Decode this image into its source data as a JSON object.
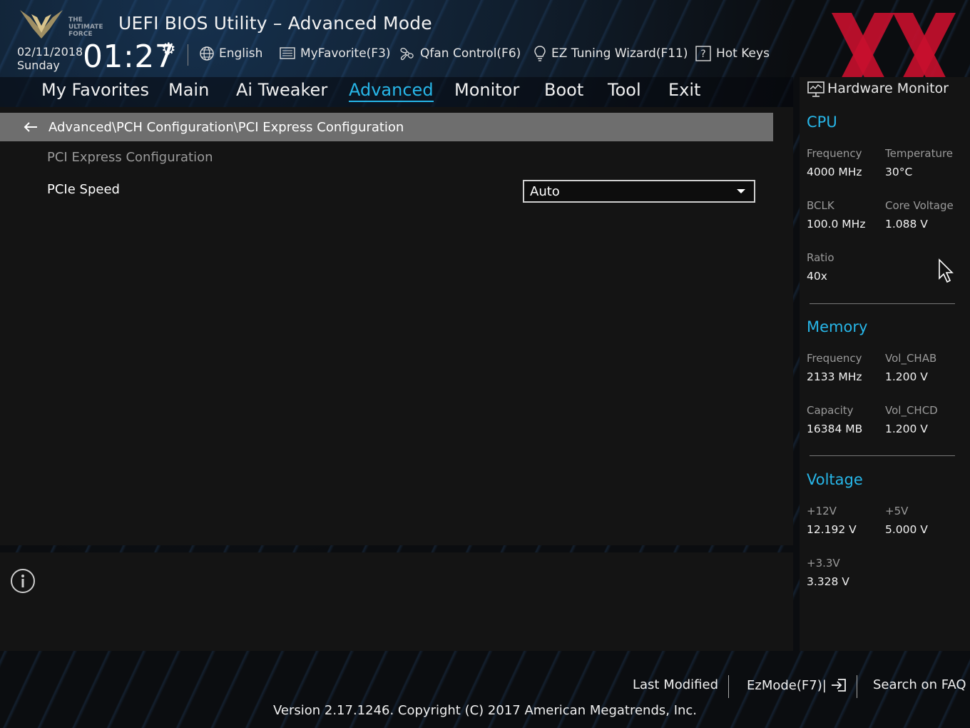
{
  "header": {
    "logo_text": "THE ULTIMATE FORCE",
    "title": "UEFI BIOS Utility – Advanced Mode",
    "date": "02/11/2018",
    "day": "Sunday",
    "time": "01:27",
    "toolbar": [
      {
        "label": "English",
        "icon": "globe-icon"
      },
      {
        "label": "MyFavorite(F3)",
        "icon": "favorite-list-icon"
      },
      {
        "label": "Qfan Control(F6)",
        "icon": "fan-icon"
      },
      {
        "label": "EZ Tuning Wizard(F11)",
        "icon": "lightbulb-icon"
      },
      {
        "label": "Hot Keys",
        "icon": "question-box-icon"
      }
    ]
  },
  "tabs": [
    {
      "label": "My Favorites",
      "active": false
    },
    {
      "label": "Main",
      "active": false
    },
    {
      "label": "Ai Tweaker",
      "active": false
    },
    {
      "label": "Advanced",
      "active": true
    },
    {
      "label": "Monitor",
      "active": false
    },
    {
      "label": "Boot",
      "active": false
    },
    {
      "label": "Tool",
      "active": false
    },
    {
      "label": "Exit",
      "active": false
    }
  ],
  "main": {
    "breadcrumb": "Advanced\\PCH Configuration\\PCI Express Configuration",
    "section_heading": "PCI Express Configuration",
    "settings": [
      {
        "label": "PCIe Speed",
        "value": "Auto"
      }
    ]
  },
  "hardware_monitor": {
    "title": "Hardware Monitor",
    "cpu": {
      "heading": "CPU",
      "frequency_label": "Frequency",
      "frequency": "4000 MHz",
      "temperature_label": "Temperature",
      "temperature": "30°C",
      "bclk_label": "BCLK",
      "bclk": "100.0 MHz",
      "core_voltage_label": "Core Voltage",
      "core_voltage": "1.088 V",
      "ratio_label": "Ratio",
      "ratio": "40x"
    },
    "memory": {
      "heading": "Memory",
      "frequency_label": "Frequency",
      "frequency": "2133 MHz",
      "vol_chab_label": "Vol_CHAB",
      "vol_chab": "1.200 V",
      "capacity_label": "Capacity",
      "capacity": "16384 MB",
      "vol_chcd_label": "Vol_CHCD",
      "vol_chcd": "1.200 V"
    },
    "voltage": {
      "heading": "Voltage",
      "v12_label": "+12V",
      "v12": "12.192 V",
      "v5_label": "+5V",
      "v5": "5.000 V",
      "v33_label": "+3.3V",
      "v33": "3.328 V"
    }
  },
  "footer": {
    "last_modified": "Last Modified",
    "ezmode": "EzMode(F7)|",
    "search_faq": "Search on FAQ",
    "version": "Version 2.17.1246. Copyright (C) 2017 American Megatrends, Inc."
  },
  "colors": {
    "accent": "#27b6e8",
    "panel": "#141414",
    "breadcrumb_bg": "#6e6e6e",
    "watermark": "#c8102e"
  }
}
